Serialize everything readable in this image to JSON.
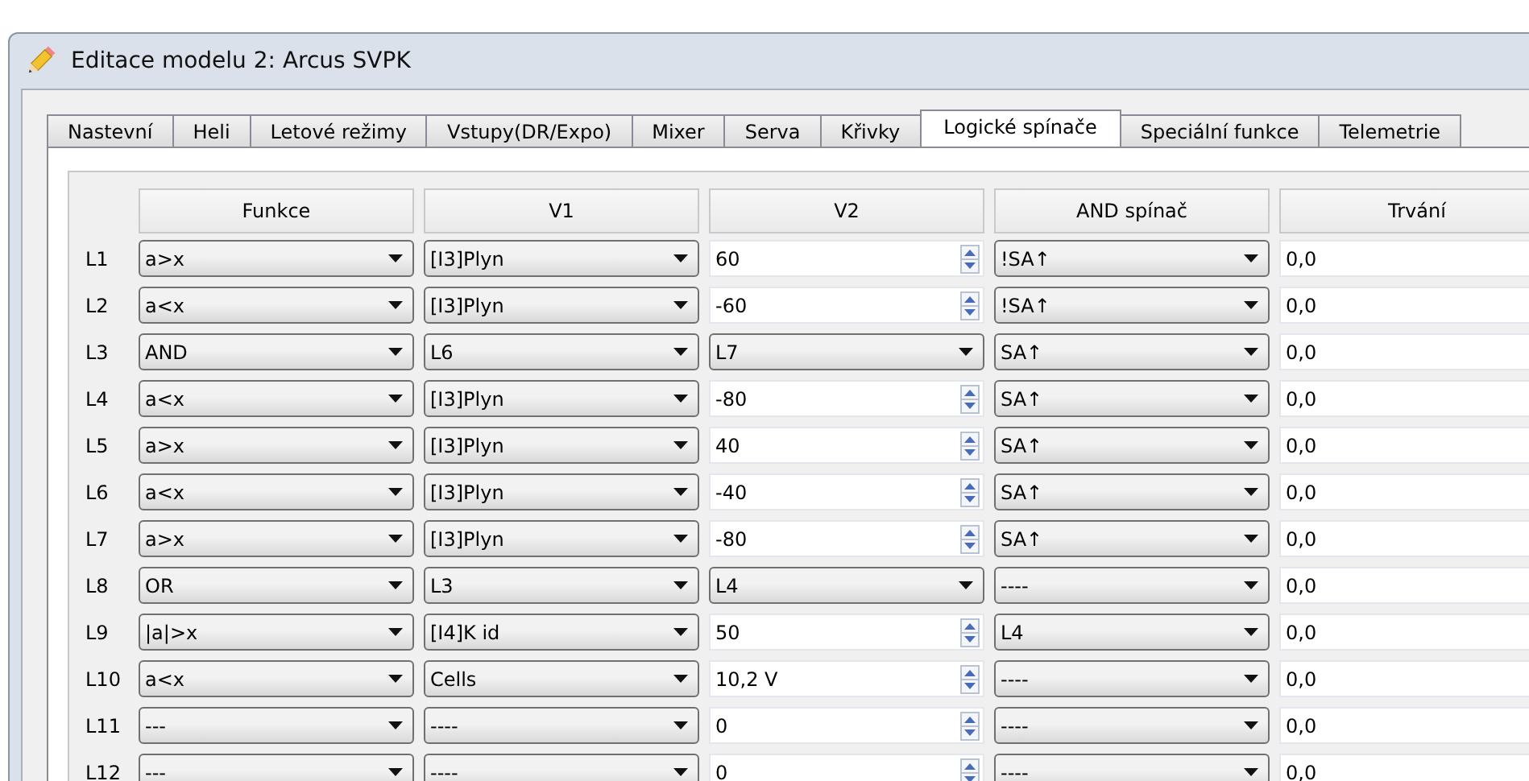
{
  "window": {
    "title": "Editace modelu 2: Arcus SVPK"
  },
  "tabs": [
    {
      "label": "Nastevní",
      "selected": false
    },
    {
      "label": "Heli",
      "selected": false
    },
    {
      "label": "Letové režimy",
      "selected": false
    },
    {
      "label": "Vstupy(DR/Expo)",
      "selected": false
    },
    {
      "label": "Mixer",
      "selected": false
    },
    {
      "label": "Serva",
      "selected": false
    },
    {
      "label": "Křivky",
      "selected": false
    },
    {
      "label": "Logické spínače",
      "selected": true
    },
    {
      "label": "Speciální funkce",
      "selected": false
    },
    {
      "label": "Telemetrie",
      "selected": false
    }
  ],
  "table": {
    "columns": [
      "Funkce",
      "V1",
      "V2",
      "AND spínač",
      "Trvání"
    ],
    "rows": [
      {
        "label": "L1",
        "funkce": "a>x",
        "v1": "[I3]Plyn",
        "v2": {
          "kind": "spin",
          "value": "60"
        },
        "and": "!SA↑",
        "trvani": "0,0"
      },
      {
        "label": "L2",
        "funkce": "a<x",
        "v1": "[I3]Plyn",
        "v2": {
          "kind": "spin",
          "value": "-60"
        },
        "and": "!SA↑",
        "trvani": "0,0"
      },
      {
        "label": "L3",
        "funkce": "AND",
        "v1": "L6",
        "v2": {
          "kind": "combo",
          "value": "L7"
        },
        "and": "SA↑",
        "trvani": "0,0"
      },
      {
        "label": "L4",
        "funkce": "a<x",
        "v1": "[I3]Plyn",
        "v2": {
          "kind": "spin",
          "value": "-80"
        },
        "and": "SA↑",
        "trvani": "0,0"
      },
      {
        "label": "L5",
        "funkce": "a>x",
        "v1": "[I3]Plyn",
        "v2": {
          "kind": "spin",
          "value": "40"
        },
        "and": "SA↑",
        "trvani": "0,0"
      },
      {
        "label": "L6",
        "funkce": "a<x",
        "v1": "[I3]Plyn",
        "v2": {
          "kind": "spin",
          "value": "-40"
        },
        "and": "SA↑",
        "trvani": "0,0"
      },
      {
        "label": "L7",
        "funkce": "a>x",
        "v1": "[I3]Plyn",
        "v2": {
          "kind": "spin",
          "value": "-80"
        },
        "and": "SA↑",
        "trvani": "0,0"
      },
      {
        "label": "L8",
        "funkce": "OR",
        "v1": "L3",
        "v2": {
          "kind": "combo",
          "value": "L4"
        },
        "and": "----",
        "trvani": "0,0"
      },
      {
        "label": "L9",
        "funkce": "|a|>x",
        "v1": "[I4]K id",
        "v2": {
          "kind": "spin",
          "value": "50"
        },
        "and": "L4",
        "trvani": "0,0"
      },
      {
        "label": "L10",
        "funkce": "a<x",
        "v1": "Cells",
        "v2": {
          "kind": "spin",
          "value": "10,2 V"
        },
        "and": "----",
        "trvani": "0,0"
      },
      {
        "label": "L11",
        "funkce": "---",
        "v1": "----",
        "v2": {
          "kind": "spin",
          "value": "0"
        },
        "and": "----",
        "trvani": "0,0"
      },
      {
        "label": "L12",
        "funkce": "---",
        "v1": "----",
        "v2": {
          "kind": "spin",
          "value": "0"
        },
        "and": "----",
        "trvani": "0,0"
      }
    ]
  }
}
